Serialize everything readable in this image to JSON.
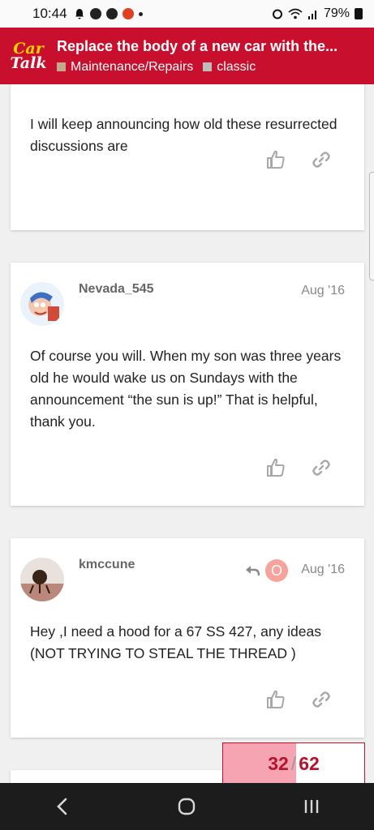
{
  "status_bar": {
    "time": "10:44",
    "battery": "79%"
  },
  "header": {
    "logo_line1": "Car",
    "logo_line2": "Talk",
    "title": "Replace the body of a new car with the...",
    "categories": [
      {
        "label": "Maintenance/Repairs",
        "color": "#c4a88a"
      },
      {
        "label": "classic",
        "color": "#bdbdbd"
      }
    ]
  },
  "posts": [
    {
      "text": "I will keep announcing how old these resurrected discussions are"
    },
    {
      "username": "Nevada_545",
      "date": "Aug '16",
      "text": "Of course you will. When my son was three years old he would wake us on Sundays with the announcement “the sun is up!” That is helpful, thank you."
    },
    {
      "username": "kmccune",
      "date": "Aug '16",
      "reply_avatar_letter": "O",
      "text": "Hey ,I need a hood for a 67 SS 427, any ideas (NOT TRYING TO STEAL THE THREAD )"
    }
  ],
  "progress": {
    "current": "32",
    "total": "62",
    "fraction": 0.516
  },
  "icons": [
    "notification-bell-icon",
    "wifi-icon",
    "signal-icon",
    "battery-icon",
    "like-icon",
    "link-icon",
    "reply-arrow-icon",
    "back-icon",
    "home-icon",
    "recents-icon"
  ],
  "colors": {
    "brand_red": "#c8102e",
    "progress_fill": "#f6a4b1",
    "progress_text": "#b4122d"
  }
}
